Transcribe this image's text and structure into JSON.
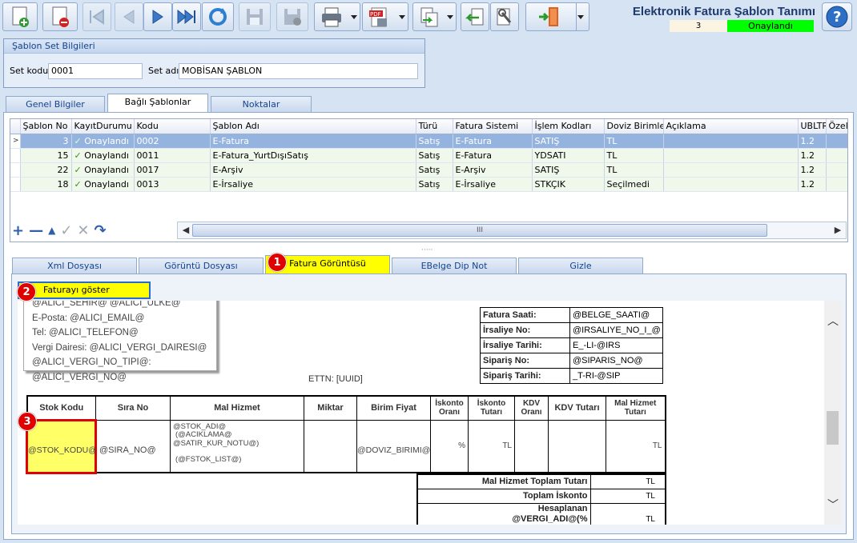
{
  "window": {
    "title": "Elektronik Fatura Şablon Tanımı",
    "record_count": "3",
    "status": "Onaylandı",
    "status_color": "#00ff00"
  },
  "toolbar": {
    "icons": [
      "new-icon",
      "delete-icon",
      "first-record-icon",
      "previous-record-icon",
      "next-record-icon",
      "last-record-icon",
      "refresh-icon",
      "save-icon",
      "save-close-icon",
      "print-icon",
      "pdf-icon",
      "export-icon",
      "import-icon",
      "tools-icon",
      "exit-icon",
      "dropdown-icon",
      "help-icon"
    ]
  },
  "set_group": {
    "header": "Şablon Set Bilgileri",
    "code_label": "Set kodu",
    "code_value": "0001",
    "name_label": "Set adı",
    "name_value": "MOBİSAN ŞABLON"
  },
  "main_tabs": [
    "Genel Bilgiler",
    "Bağlı Şablonlar",
    "Noktalar"
  ],
  "grid": {
    "columns": [
      "Şablon No",
      "KayıtDurumu",
      "Kodu",
      "Şablon Adı",
      "Türü",
      "Fatura Sistemi",
      "İşlem Kodları",
      "Doviz Birimleri",
      "Açıklama",
      "UBLTR",
      "Özel I"
    ],
    "rows": [
      {
        "no": "3",
        "status": "Onaylandı",
        "code": "0002",
        "name": "E-Fatura",
        "type": "Satış",
        "system": "E-Fatura",
        "ops": "SATIŞ",
        "currency": "TL",
        "desc": "",
        "ubl": "1.2"
      },
      {
        "no": "15",
        "status": "Onaylandı",
        "code": "0011",
        "name": "E-Fatura_YurtDışıSatış",
        "type": "Satış",
        "system": "E-Fatura",
        "ops": "YDSATI",
        "currency": "TL",
        "desc": "",
        "ubl": "1.2"
      },
      {
        "no": "22",
        "status": "Onaylandı",
        "code": "0017",
        "name": "E-Arşiv",
        "type": "Satış",
        "system": "E-Arşiv",
        "ops": "SATIŞ",
        "currency": "TL",
        "desc": "",
        "ubl": "1.2"
      },
      {
        "no": "18",
        "status": "Onaylandı",
        "code": "0013",
        "name": "E-İrsaliye",
        "type": "Satış",
        "system": "E-İrsaliye",
        "ops": "STKÇIK",
        "currency": "Seçilmedi",
        "desc": "",
        "ubl": "1.2"
      }
    ],
    "navigator": [
      "add-icon",
      "remove-icon",
      "up-icon",
      "confirm-icon",
      "cancel-icon",
      "undo-icon"
    ],
    "hscroll_label": "III"
  },
  "sub_tabs": [
    "Xml Dosyası",
    "Görüntü Dosyası",
    "Fatura Görüntüsü",
    "EBelge Dip Not",
    "Gizle"
  ],
  "show_button": "Faturayı göster",
  "markers": [
    "1",
    "2",
    "3"
  ],
  "invoice": {
    "buyer_lines": [
      "@ALICI_SEHIR@ @ALICI_ULKE@",
      "E-Posta: @ALICI_EMAIL@",
      "Tel: @ALICI_TELEFON@",
      "Vergi Dairesi: @ALICI_VERGI_DAIRESI@",
      "@ALICI_VERGI_NO_TIPI@:",
      "@ALICI_VERGI_NO@"
    ],
    "info_rows": [
      {
        "label": "Fatura Saati:",
        "value": "@BELGE_SAATI@"
      },
      {
        "label": "İrsaliye No:",
        "value": "@IRSALIYE_NO_I_@"
      },
      {
        "label": "İrsaliye Tarihi:",
        "value": "E_-LI-@IRS"
      },
      {
        "label": "Sipariş No:",
        "value": "@SIPARIS_NO@"
      },
      {
        "label": "Sipariş Tarihi:",
        "value": "_T-RI-@SIP"
      }
    ],
    "ettn": "ETTN: [UUID]",
    "table_headers": [
      "Stok Kodu",
      "Sıra No",
      "Mal Hizmet",
      "Miktar",
      "Birim Fiyat",
      "İskonto Oranı",
      "İskonto Tutarı",
      "KDV Oranı",
      "KDV Tutarı",
      "Mal Hizmet Tutarı"
    ],
    "row": {
      "stok": "@STOK_KODU@",
      "sira": "@SIRA_NO@",
      "mal_lines": [
        "@STOK_ADI@",
        "(@ACIKLAMA@",
        "@SATIR_KUR_NOTU@)",
        "",
        "(@FSTOK_LIST@)"
      ],
      "birim": "@DOVIZ_BIRIMI@",
      "isk_oran": "%",
      "isk_tutar": "TL",
      "mal_tutar": "TL"
    },
    "totals": [
      {
        "label": "Mal Hizmet Toplam Tutarı",
        "value": "TL"
      },
      {
        "label": "Toplam İskonto",
        "value": "TL"
      },
      {
        "label": "Hesaplanan @VERGI_ADI@(% @VERGI_ORANI@)",
        "value": "TL"
      }
    ]
  }
}
